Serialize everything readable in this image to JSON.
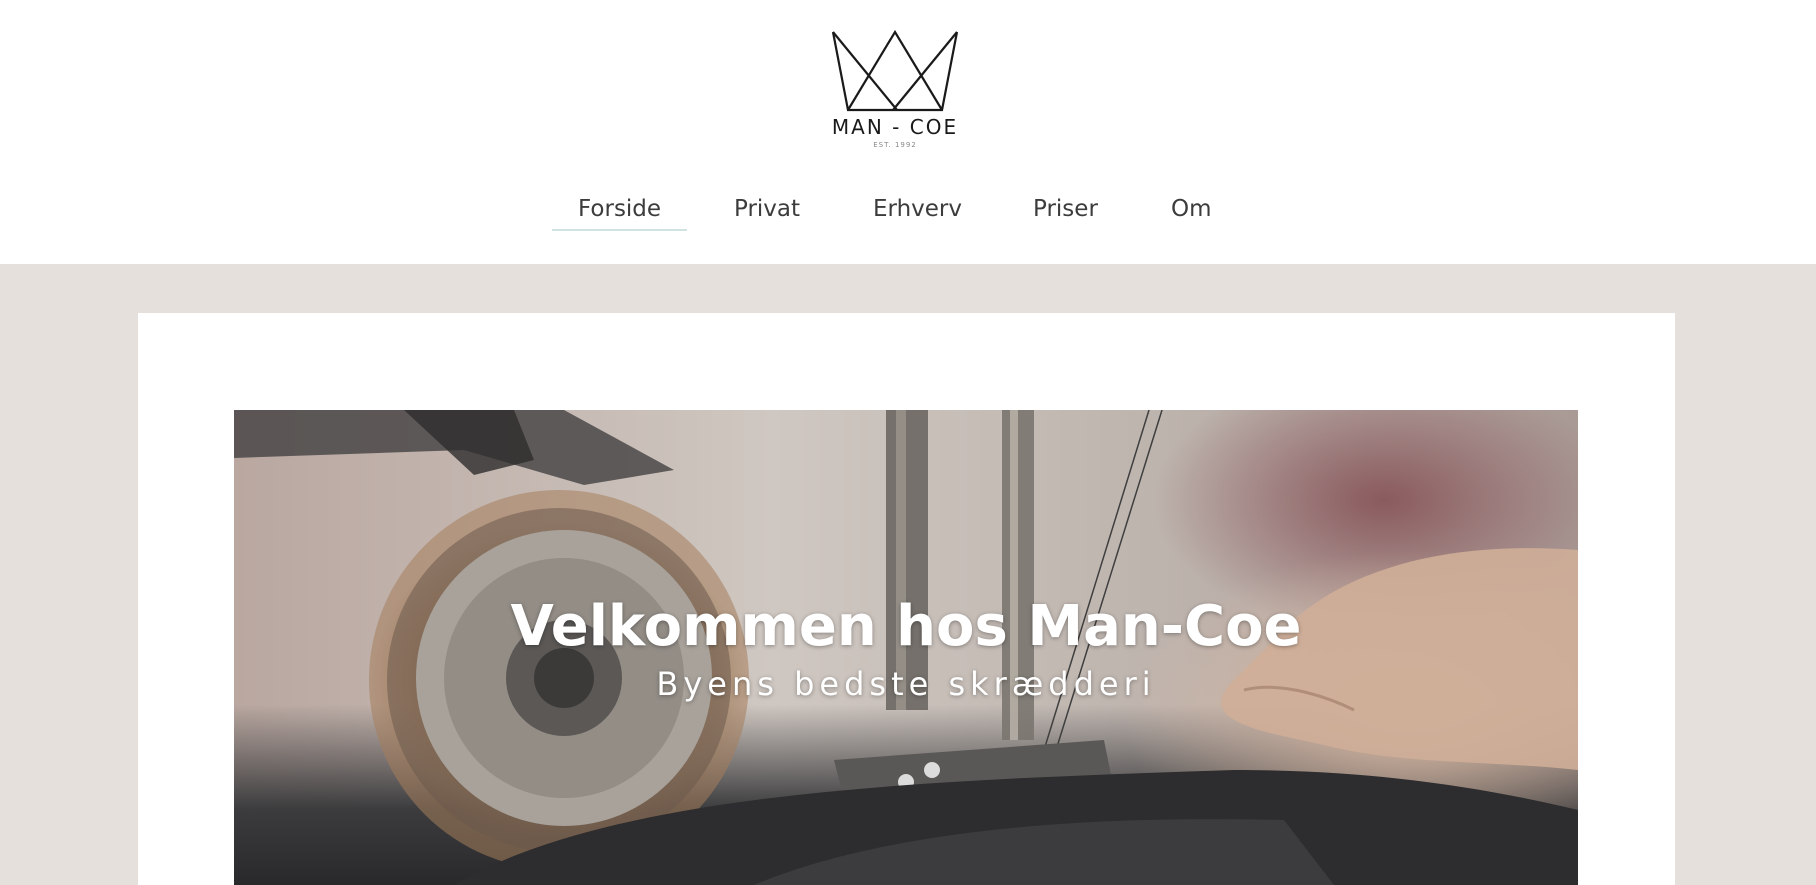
{
  "brand": {
    "name": "MAN - COE",
    "established": "EST. 1992",
    "logo_icon": "crown-icon"
  },
  "nav": {
    "items": [
      {
        "label": "Forside",
        "active": true
      },
      {
        "label": "Privat",
        "active": false
      },
      {
        "label": "Erhverv",
        "active": false
      },
      {
        "label": "Priser",
        "active": false
      },
      {
        "label": "Om",
        "active": false
      }
    ]
  },
  "hero": {
    "title": "Velkommen hos Man-Coe",
    "subtitle": "Byens bedste skrædderi",
    "image": "sewing-machine-photo"
  },
  "colors": {
    "band_background": "#e5e0dc",
    "active_nav_underline": "#cfe3e2",
    "nav_text": "#3c3c3c"
  }
}
